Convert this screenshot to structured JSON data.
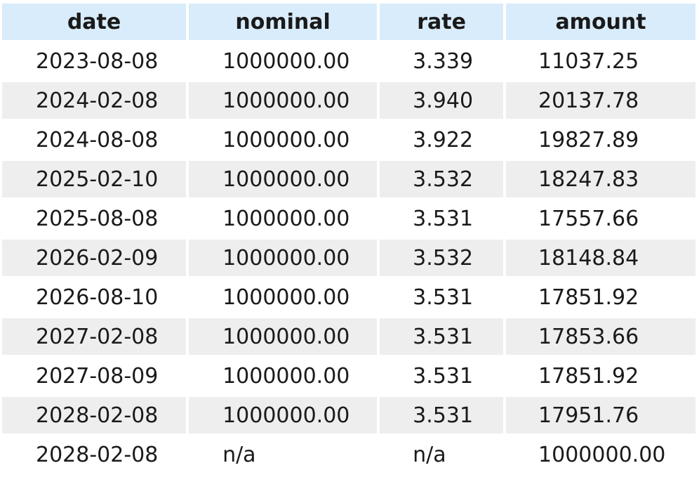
{
  "table": {
    "headers": [
      "date",
      "nominal",
      "rate",
      "amount"
    ],
    "rows": [
      [
        "2023-08-08",
        "1000000.00",
        "3.339",
        "11037.25"
      ],
      [
        "2024-02-08",
        "1000000.00",
        "3.940",
        "20137.78"
      ],
      [
        "2024-08-08",
        "1000000.00",
        "3.922",
        "19827.89"
      ],
      [
        "2025-02-10",
        "1000000.00",
        "3.532",
        "18247.83"
      ],
      [
        "2025-08-08",
        "1000000.00",
        "3.531",
        "17557.66"
      ],
      [
        "2026-02-09",
        "1000000.00",
        "3.532",
        "18148.84"
      ],
      [
        "2026-08-10",
        "1000000.00",
        "3.531",
        "17851.92"
      ],
      [
        "2027-02-08",
        "1000000.00",
        "3.531",
        "17853.66"
      ],
      [
        "2027-08-09",
        "1000000.00",
        "3.531",
        "17851.92"
      ],
      [
        "2028-02-08",
        "1000000.00",
        "3.531",
        "17951.76"
      ],
      [
        "2028-02-08",
        "n/a",
        "n/a",
        "1000000.00"
      ]
    ]
  },
  "colors": {
    "header_background": "#d9ecfb",
    "stripe_background": "#eeeeee",
    "text": "#1a1a1a"
  }
}
